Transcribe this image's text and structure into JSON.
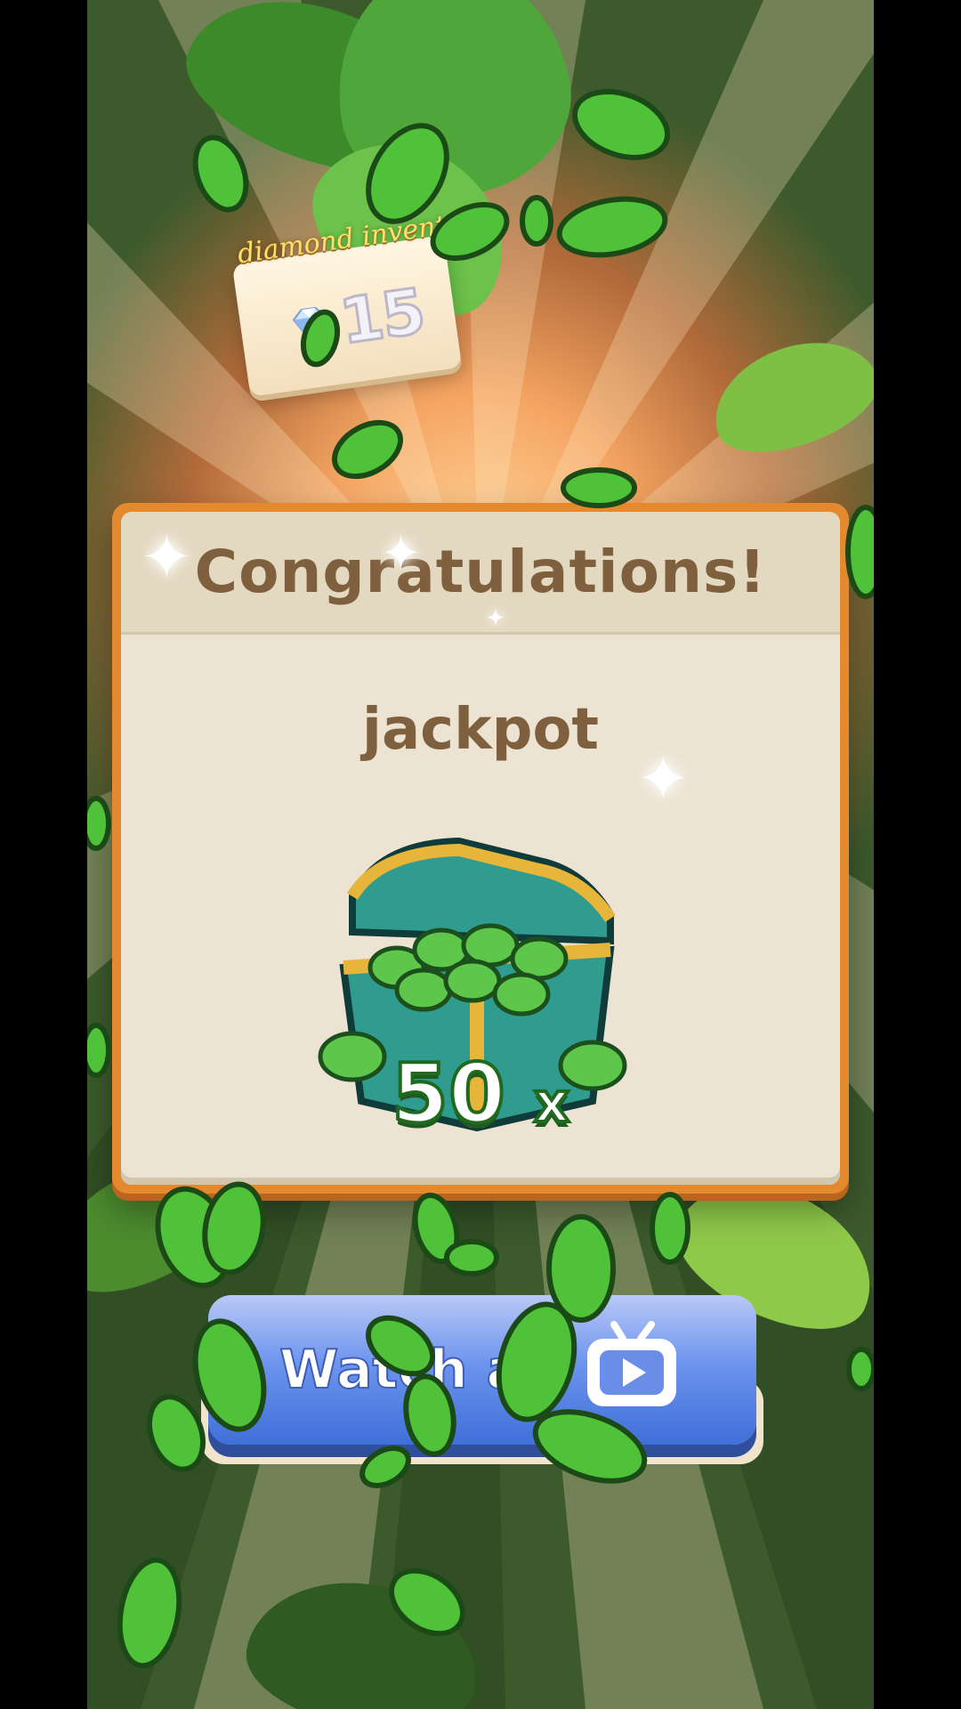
{
  "inventory": {
    "label": "diamond inventory",
    "count": "15",
    "icon": "diamond-icon"
  },
  "dialog": {
    "title": "Congratulations!",
    "prize_name": "jackpot",
    "multiplier_value": "50",
    "multiplier_suffix": "x",
    "prize_icon": "treasure-chest-icon"
  },
  "watch_button": {
    "label": "Watch ad",
    "icon": "tv-play-icon"
  },
  "colors": {
    "dialog_border": "#e4892e",
    "dialog_body": "#ece3d2",
    "title_text": "#7e5f3e",
    "button_blue": "#4f7ee3",
    "coin_green": "#3fb83f"
  }
}
